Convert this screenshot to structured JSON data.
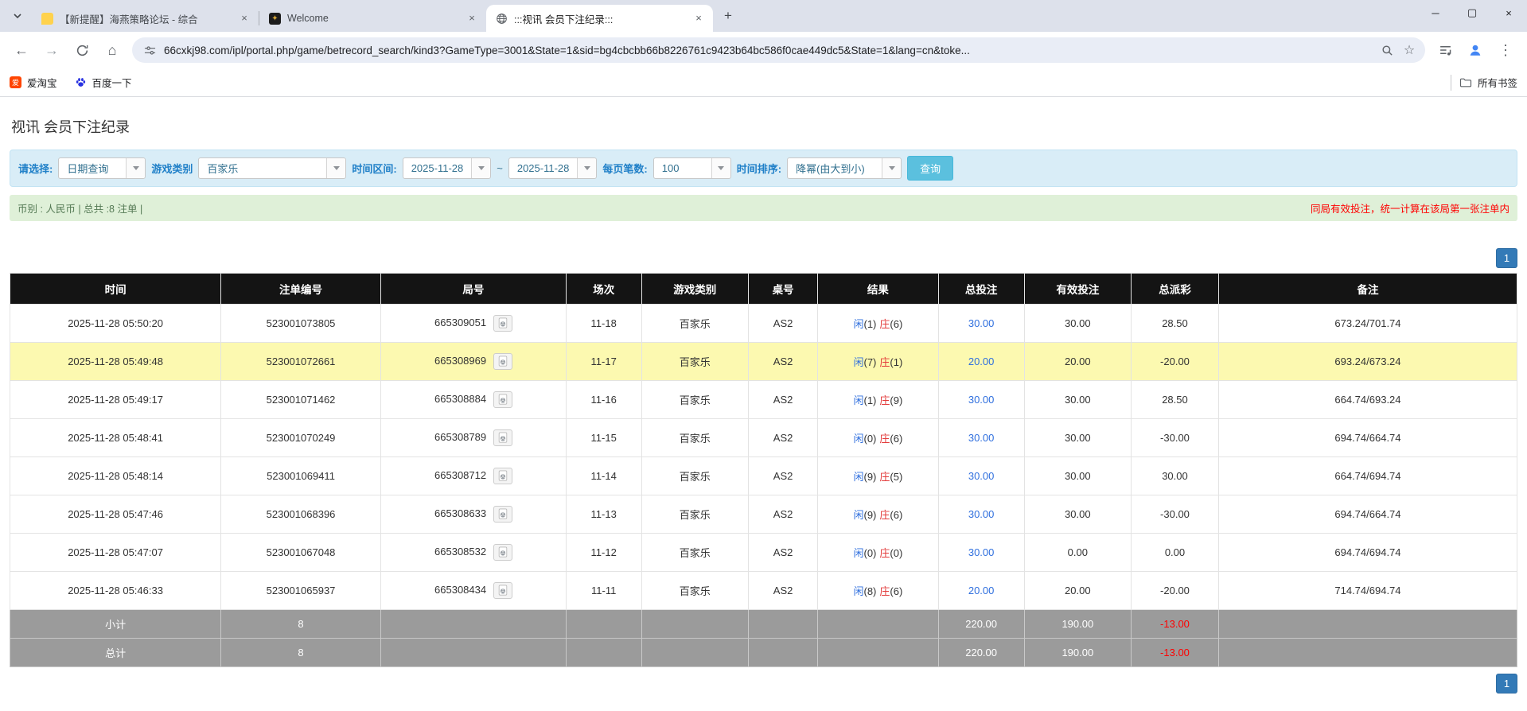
{
  "browser": {
    "tabs": [
      {
        "title": "【新提醒】海燕策略论坛 - 综合",
        "active": false
      },
      {
        "title": "Welcome",
        "active": false
      },
      {
        "title": ":::视讯 会员下注纪录:::",
        "active": true
      }
    ],
    "window_controls": {
      "minimize": "─",
      "maximize": "▢",
      "close": "×"
    },
    "url": "66cxkj98.com/ipl/portal.php/game/betrecord_search/kind3?GameType=3001&State=1&sid=bg4cbcbb66b8226761c9423b64bc586f0cae449dc5&State=1&lang=cn&toke...",
    "bookmarks": [
      {
        "label": "爱淘宝"
      },
      {
        "label": "百度一下"
      }
    ],
    "all_bookmarks_label": "所有书签"
  },
  "page": {
    "title": "视讯 会员下注纪录",
    "filters": {
      "select_label": "请选择:",
      "select_value": "日期查询",
      "game_type_label": "游戏类别",
      "game_type_value": "百家乐",
      "date_range_label": "时间区间:",
      "date_from": "2025-11-28",
      "tilde": "~",
      "date_to": "2025-11-28",
      "page_size_label": "每页笔数:",
      "page_size_value": "100",
      "sort_label": "时间排序:",
      "sort_value": "降幂(由大到小)",
      "search_button": "查询"
    },
    "status_bar": {
      "left": "币别 : 人民币 | 总共 :8 注单 |",
      "right": "同局有效投注，统一计算在该局第一张注单内"
    },
    "pagination": "1",
    "table": {
      "headers": [
        "时间",
        "注单编号",
        "局号",
        "场次",
        "游戏类别",
        "桌号",
        "结果",
        "总投注",
        "有效投注",
        "总派彩",
        "备注"
      ],
      "rows": [
        {
          "time": "2025-11-28 05:50:20",
          "bet": "523001073805",
          "round": "665309051",
          "sess": "11-18",
          "game": "百家乐",
          "tbl": "AS2",
          "p": "闲",
          "pn": "(1)",
          "b": "庄",
          "bn": "(6)",
          "total": "30.00",
          "valid": "30.00",
          "pay": "28.50",
          "note": "673.24/701.74",
          "highlighted": false
        },
        {
          "time": "2025-11-28 05:49:48",
          "bet": "523001072661",
          "round": "665308969",
          "sess": "11-17",
          "game": "百家乐",
          "tbl": "AS2",
          "p": "闲",
          "pn": "(7)",
          "b": "庄",
          "bn": "(1)",
          "total": "20.00",
          "valid": "20.00",
          "pay": "-20.00",
          "note": "693.24/673.24",
          "highlighted": true
        },
        {
          "time": "2025-11-28 05:49:17",
          "bet": "523001071462",
          "round": "665308884",
          "sess": "11-16",
          "game": "百家乐",
          "tbl": "AS2",
          "p": "闲",
          "pn": "(1)",
          "b": "庄",
          "bn": "(9)",
          "total": "30.00",
          "valid": "30.00",
          "pay": "28.50",
          "note": "664.74/693.24",
          "highlighted": false
        },
        {
          "time": "2025-11-28 05:48:41",
          "bet": "523001070249",
          "round": "665308789",
          "sess": "11-15",
          "game": "百家乐",
          "tbl": "AS2",
          "p": "闲",
          "pn": "(0)",
          "b": "庄",
          "bn": "(6)",
          "total": "30.00",
          "valid": "30.00",
          "pay": "-30.00",
          "note": "694.74/664.74",
          "highlighted": false
        },
        {
          "time": "2025-11-28 05:48:14",
          "bet": "523001069411",
          "round": "665308712",
          "sess": "11-14",
          "game": "百家乐",
          "tbl": "AS2",
          "p": "闲",
          "pn": "(9)",
          "b": "庄",
          "bn": "(5)",
          "total": "30.00",
          "valid": "30.00",
          "pay": "30.00",
          "note": "664.74/694.74",
          "highlighted": false
        },
        {
          "time": "2025-11-28 05:47:46",
          "bet": "523001068396",
          "round": "665308633",
          "sess": "11-13",
          "game": "百家乐",
          "tbl": "AS2",
          "p": "闲",
          "pn": "(9)",
          "b": "庄",
          "bn": "(6)",
          "total": "30.00",
          "valid": "30.00",
          "pay": "-30.00",
          "note": "694.74/664.74",
          "highlighted": false
        },
        {
          "time": "2025-11-28 05:47:07",
          "bet": "523001067048",
          "round": "665308532",
          "sess": "11-12",
          "game": "百家乐",
          "tbl": "AS2",
          "p": "闲",
          "pn": "(0)",
          "b": "庄",
          "bn": "(0)",
          "total": "30.00",
          "valid": "0.00",
          "pay": "0.00",
          "note": "694.74/694.74",
          "highlighted": false
        },
        {
          "time": "2025-11-28 05:46:33",
          "bet": "523001065937",
          "round": "665308434",
          "sess": "11-11",
          "game": "百家乐",
          "tbl": "AS2",
          "p": "闲",
          "pn": "(8)",
          "b": "庄",
          "bn": "(6)",
          "total": "20.00",
          "valid": "20.00",
          "pay": "-20.00",
          "note": "714.74/694.74",
          "highlighted": false
        }
      ],
      "subtotal": {
        "label": "小计",
        "count": "8",
        "total": "220.00",
        "valid": "190.00",
        "pay": "-13.00"
      },
      "total": {
        "label": "总计",
        "count": "8",
        "total": "220.00",
        "valid": "190.00",
        "pay": "-13.00"
      }
    }
  },
  "colors": {
    "accent_blue": "#337ab7",
    "link_blue": "#2f6fde",
    "banker_red": "#e33c3c",
    "negative_red": "#ff0000",
    "highlight_yellow": "#fcf9b0",
    "filter_bg": "#d9edf7",
    "status_green_bg": "#dff0d8",
    "search_button_cyan": "#5bc0de",
    "table_header_bg": "#141414",
    "footer_gray": "#9b9b9b"
  }
}
